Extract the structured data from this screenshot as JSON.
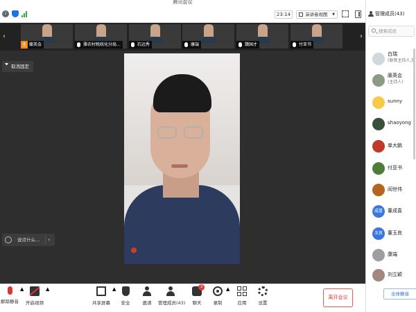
{
  "app": {
    "title": "腾讯会议"
  },
  "header": {
    "timer": "23:14",
    "view_mode": "演讲者视图"
  },
  "thumbnails": [
    {
      "name": "藤英会",
      "host_badge": "主"
    },
    {
      "name": "雅农村税统化分局..."
    },
    {
      "name": "石远秀"
    },
    {
      "name": "康端"
    },
    {
      "name": "魏国才"
    },
    {
      "name": "付亚书"
    }
  ],
  "stage": {
    "unpin_label": "取消固定",
    "chat_placeholder": "说点什么..."
  },
  "toolbar": {
    "mute": "解除静音",
    "video": "开启视频",
    "share": "共享屏幕",
    "security": "安全",
    "invite": "邀请",
    "members": "管理成员(43)",
    "chat": "聊天",
    "chat_badge": "3",
    "record": "录制",
    "apps": "应用",
    "settings": "设置",
    "leave": "离开会议"
  },
  "sidebar": {
    "title": "管理成员(43)",
    "search_placeholder": "搜索成员",
    "members": [
      {
        "name": "白瑞",
        "role": "(联席主持人,我)",
        "avatar_color": "#cfd8dc"
      },
      {
        "name": "藤英会",
        "role": "(主持人)",
        "avatar_color": "#8d9b86"
      },
      {
        "name": "sunny",
        "role": "",
        "avatar_color": "#f7c948"
      },
      {
        "name": "shaoyong",
        "role": "",
        "avatar_color": "#37513a"
      },
      {
        "name": "单大鹏",
        "role": "",
        "avatar_color": "#c0392b"
      },
      {
        "name": "付亚书",
        "role": "",
        "avatar_color": "#4e7d3a"
      },
      {
        "name": "阎世伟",
        "role": "",
        "avatar_color": "#b5651d"
      },
      {
        "name": "董成喜",
        "role": "",
        "avatar_color": "#3a78e0",
        "initials": "成喜"
      },
      {
        "name": "董玉良",
        "role": "",
        "avatar_color": "#3a78e0",
        "initials": "玉良"
      },
      {
        "name": "康端",
        "role": "",
        "avatar_color": "#9e9e9e"
      },
      {
        "name": "刘立颖",
        "role": "",
        "avatar_color": "#a1887f"
      }
    ],
    "mute_all": "全体静音"
  }
}
